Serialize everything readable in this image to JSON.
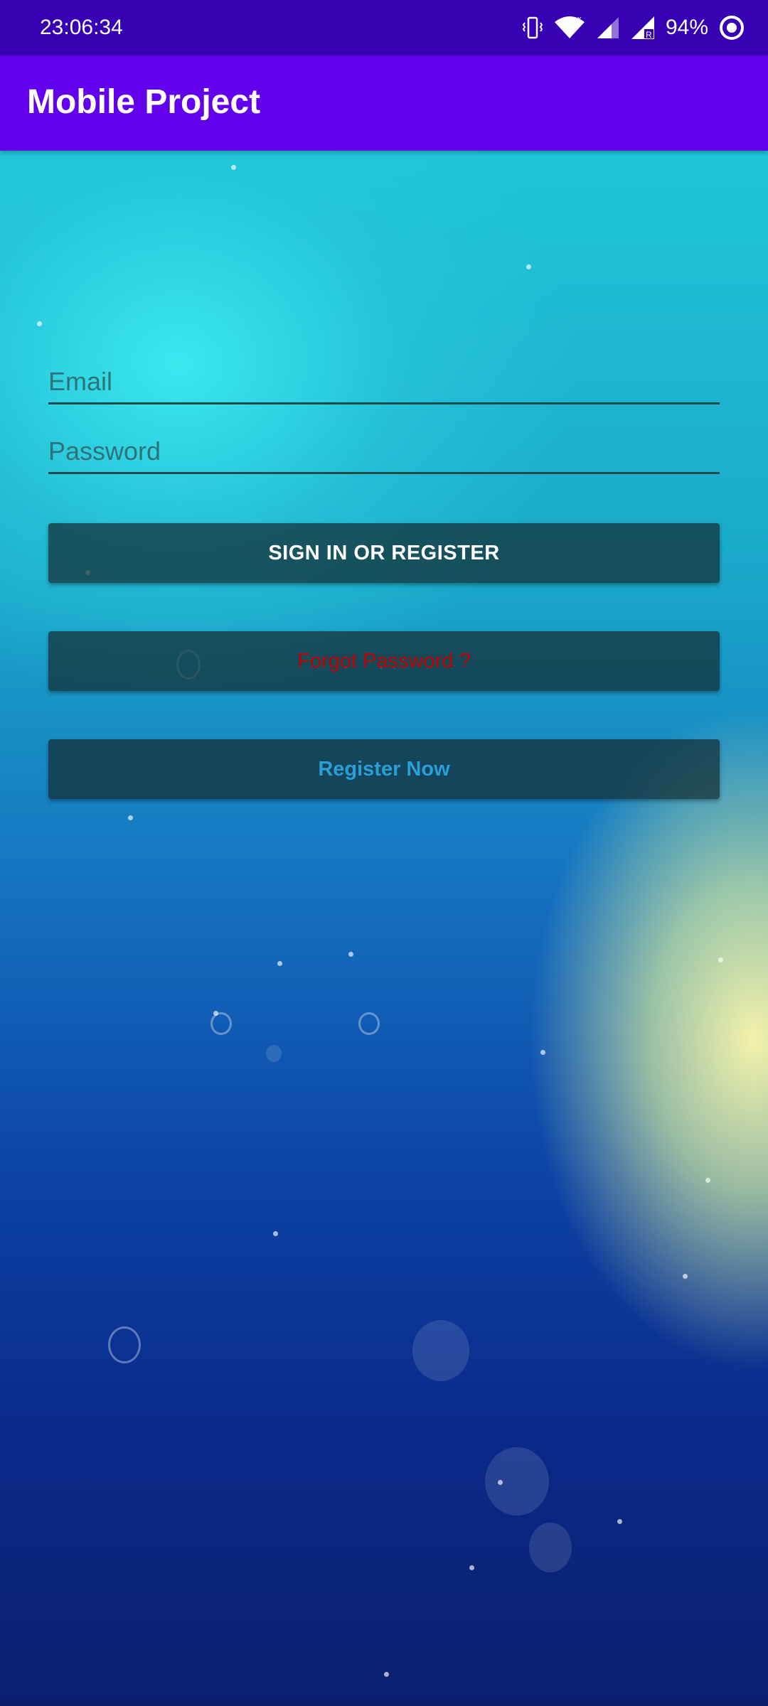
{
  "status_bar": {
    "time": "23:06:34",
    "battery": "94%",
    "icons": [
      "vibrate-icon",
      "wifi-icon",
      "cell-signal-icon",
      "cell-signal-roaming-icon",
      "sync-icon"
    ]
  },
  "app_bar": {
    "title": "Mobile Project",
    "color": "#6200ee"
  },
  "form": {
    "email_placeholder": "Email",
    "email_value": "",
    "password_placeholder": "Password",
    "password_value": ""
  },
  "buttons": {
    "signin_label": "SIGN IN OR REGISTER",
    "forgot_label": "Forgot Password ?",
    "register_label": "Register Now"
  },
  "colors": {
    "status_bar": "#3700b3",
    "forgot_text": "#c20000",
    "register_text": "#2a9ed6"
  }
}
